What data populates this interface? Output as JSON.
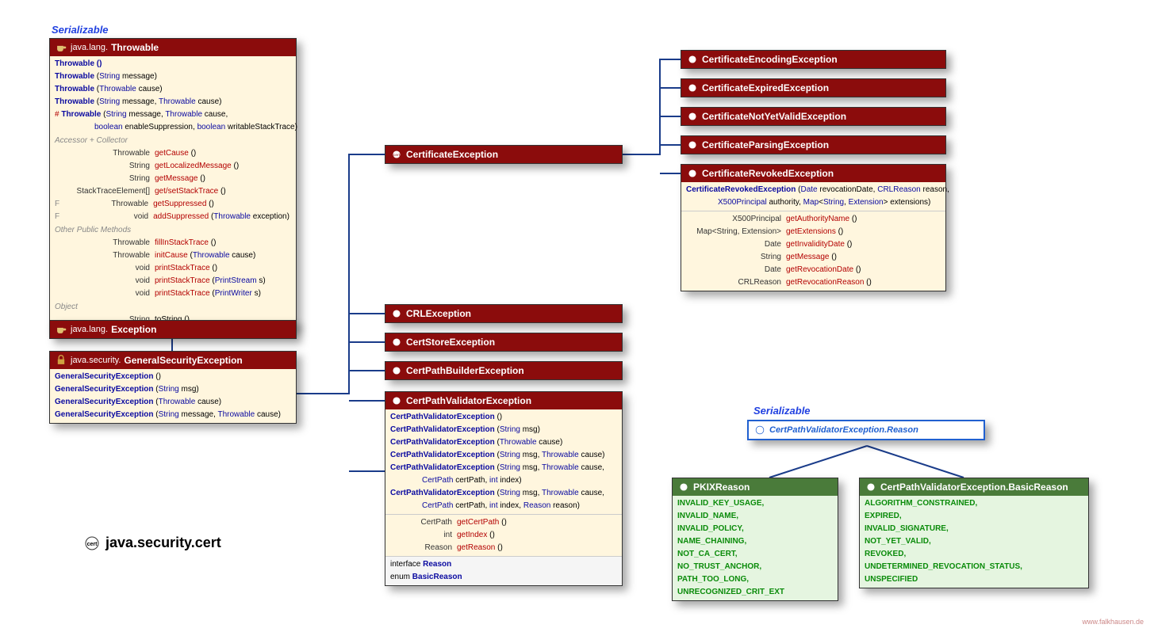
{
  "stereo1": "Serializable",
  "stereo2": "Serializable",
  "pkgLabel": "java.security.cert",
  "watermark": "www.falkhausen.de",
  "throwable": {
    "pkg": "java.lang.",
    "name": "Throwable",
    "ctors": [
      "Throwable ()",
      "Throwable (String message)",
      "Throwable (Throwable cause)",
      "Throwable (String message, Throwable cause)",
      "# Throwable (String message, Throwable cause,",
      "            boolean enableSuppression, boolean writableStackTrace)"
    ],
    "secA": "Accessor + Collector",
    "accessors": [
      [
        "Throwable",
        "getCause ()"
      ],
      [
        "String",
        "getLocalizedMessage ()"
      ],
      [
        "String",
        "getMessage ()"
      ],
      [
        "StackTraceElement[]",
        "get/setStackTrace ()"
      ],
      [
        "Throwable",
        "getSuppressed ()"
      ],
      [
        "void",
        "addSuppressed (Throwable exception)"
      ]
    ],
    "secB": "Other Public Methods",
    "others": [
      [
        "Throwable",
        "fillInStackTrace ()"
      ],
      [
        "Throwable",
        "initCause (Throwable cause)"
      ],
      [
        "void",
        "printStackTrace ()"
      ],
      [
        "void",
        "printStackTrace (PrintStream s)"
      ],
      [
        "void",
        "printStackTrace (PrintWriter s)"
      ]
    ],
    "secC": "Object",
    "obj": [
      [
        "String",
        "toString ()"
      ]
    ]
  },
  "exception": {
    "pkg": "java.lang.",
    "name": "Exception"
  },
  "gse": {
    "pkg": "java.security.",
    "name": "GeneralSecurityException",
    "ctors": [
      "GeneralSecurityException ()",
      "GeneralSecurityException (String msg)",
      "GeneralSecurityException (Throwable cause)",
      "GeneralSecurityException (String message, Throwable cause)"
    ]
  },
  "certEx": "CertificateException",
  "crlEx": "CRLException",
  "certStoreEx": "CertStoreException",
  "cpbEx": "CertPathBuilderException",
  "cpvEx": {
    "name": "CertPathValidatorException",
    "ctors": [
      "CertPathValidatorException ()",
      "CertPathValidatorException (String msg)",
      "CertPathValidatorException (Throwable cause)",
      "CertPathValidatorException (String msg, Throwable cause)",
      "CertPathValidatorException (String msg, Throwable cause,",
      "        CertPath certPath, int index)",
      "CertPathValidatorException (String msg, Throwable cause,",
      "        CertPath certPath, int index, Reason reason)"
    ],
    "methods": [
      [
        "CertPath",
        "getCertPath ()"
      ],
      [
        "int",
        "getIndex ()"
      ],
      [
        "Reason",
        "getReason ()"
      ]
    ],
    "inner": [
      "interface Reason",
      "enum BasicReason"
    ]
  },
  "certEncEx": "CertificateEncodingException",
  "certExpEx": "CertificateExpiredException",
  "certNyvEx": "CertificateNotYetValidException",
  "certParseEx": "CertificateParsingException",
  "certRevEx": {
    "name": "CertificateRevokedException",
    "ctor": "CertificateRevokedException (Date revocationDate, CRLReason reason,",
    "ctor2": "        X500Principal authority, Map<String, Extension> extensions)",
    "methods": [
      [
        "X500Principal",
        "getAuthorityName ()"
      ],
      [
        "Map<String, Extension>",
        "getExtensions ()"
      ],
      [
        "Date",
        "getInvalidityDate ()"
      ],
      [
        "String",
        "getMessage ()"
      ],
      [
        "Date",
        "getRevocationDate ()"
      ],
      [
        "CRLReason",
        "getRevocationReason ()"
      ]
    ]
  },
  "reasonIf": "CertPathValidatorException.Reason",
  "pkix": {
    "name": "PKIXReason",
    "vals": [
      "INVALID_KEY_USAGE,",
      "INVALID_NAME,",
      "INVALID_POLICY,",
      "NAME_CHAINING,",
      "NOT_CA_CERT,",
      "NO_TRUST_ANCHOR,",
      "PATH_TOO_LONG,",
      "UNRECOGNIZED_CRIT_EXT"
    ]
  },
  "basic": {
    "name": "CertPathValidatorException.BasicReason",
    "vals": [
      "ALGORITHM_CONSTRAINED,",
      "EXPIRED,",
      "INVALID_SIGNATURE,",
      "NOT_YET_VALID,",
      "REVOKED,",
      "UNDETERMINED_REVOCATION_STATUS,",
      "UNSPECIFIED"
    ]
  }
}
